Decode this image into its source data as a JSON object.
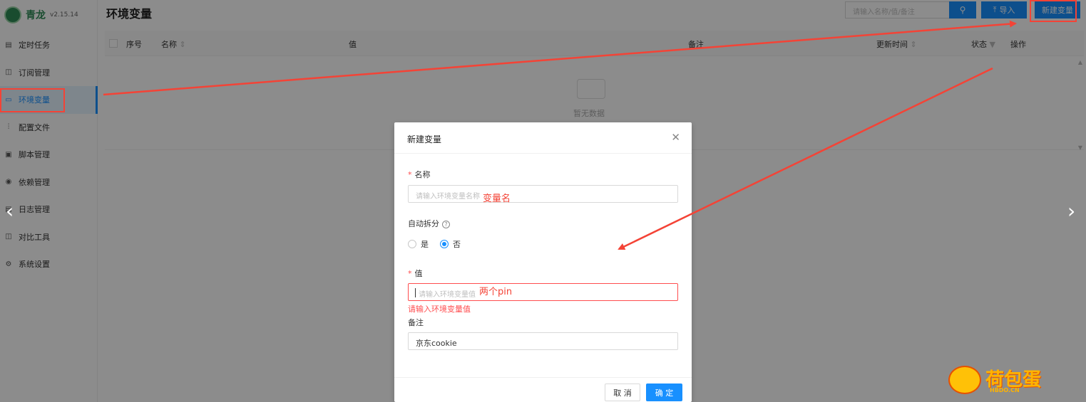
{
  "app": {
    "name": "青龙",
    "version": "v2.15.14"
  },
  "sidebar": {
    "items": [
      {
        "label": "定时任务",
        "icon": "calendar-icon"
      },
      {
        "label": "订阅管理",
        "icon": "subscription-icon"
      },
      {
        "label": "环境变量",
        "icon": "monitor-icon",
        "active": true
      },
      {
        "label": "配置文件",
        "icon": "sliders-icon"
      },
      {
        "label": "脚本管理",
        "icon": "script-icon"
      },
      {
        "label": "依赖管理",
        "icon": "dependency-icon"
      },
      {
        "label": "日志管理",
        "icon": "log-icon"
      },
      {
        "label": "对比工具",
        "icon": "compare-icon"
      },
      {
        "label": "系统设置",
        "icon": "gear-icon"
      }
    ]
  },
  "header": {
    "title": "环境变量",
    "search_placeholder": "请输入名称/值/备注",
    "import_label": "导入",
    "new_label": "新建变量"
  },
  "table": {
    "columns": [
      "序号",
      "名称",
      "值",
      "备注",
      "更新时间",
      "状态",
      "操作"
    ],
    "empty_text": "暂无数据"
  },
  "modal": {
    "title": "新建变量",
    "name_label": "名称",
    "name_placeholder": "请输入环境变量名称",
    "auto_split_label": "自动拆分",
    "radio_yes": "是",
    "radio_no": "否",
    "radio_selected": "否",
    "value_label": "值",
    "value_placeholder": "请输入环境变量值",
    "value_error": "请输入环境变量值",
    "remark_label": "备注",
    "remark_value": "京东cookie",
    "cancel_label": "取 消",
    "ok_label": "确 定"
  },
  "annotations": {
    "name_hint": "变量名",
    "value_hint": "两个pin"
  },
  "watermark": {
    "text": "荷包蛋",
    "sub": "HBDO.CN"
  },
  "colors": {
    "primary": "#1890ff",
    "annotation": "#f44336",
    "error": "#ff4d4f"
  }
}
